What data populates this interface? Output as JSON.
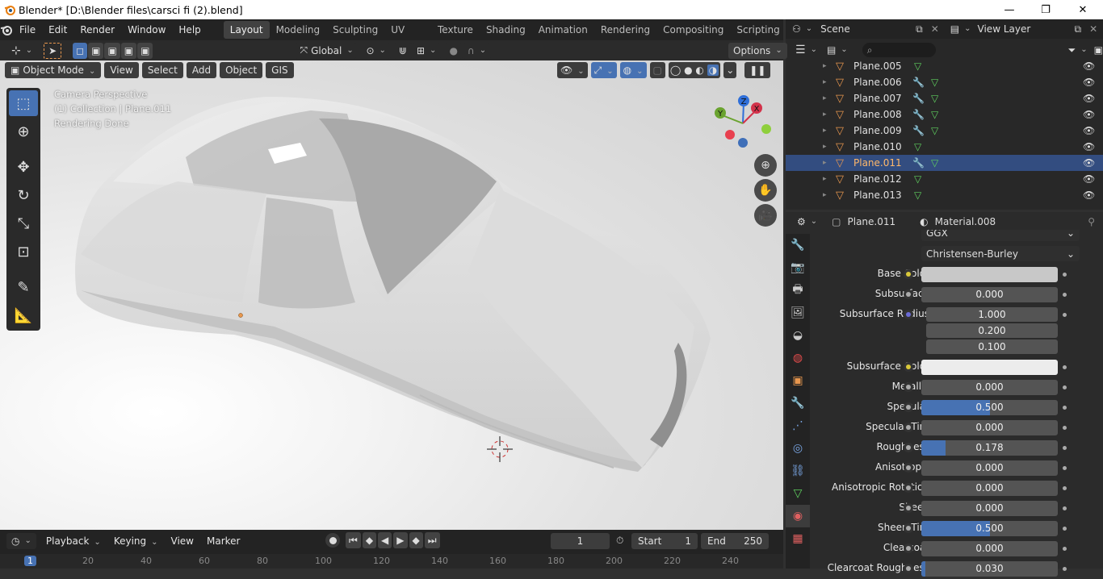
{
  "window": {
    "title": "Blender* [D:\\Blender files\\carsci fi (2).blend]",
    "minimize": "—",
    "restore": "❐",
    "close": "✕"
  },
  "menus": [
    "File",
    "Edit",
    "Render",
    "Window",
    "Help"
  ],
  "workspaces": [
    "Layout",
    "Modeling",
    "Sculpting",
    "UV Editing",
    "Texture Paint",
    "Shading",
    "Animation",
    "Rendering",
    "Compositing",
    "Scripting"
  ],
  "toolheader": {
    "orientation": "Global",
    "options": "Options"
  },
  "viewport": {
    "mode": "Object Mode",
    "menus": [
      "View",
      "Select",
      "Add",
      "Object",
      "GIS"
    ],
    "overlay_lines": [
      "Camera Perspective",
      "(1) Collection | Plane.011",
      "Rendering Done"
    ]
  },
  "gizmo": {
    "x": "X",
    "y": "Y",
    "z": "Z"
  },
  "scene": {
    "scene_name": "Scene",
    "view_layer": "View Layer"
  },
  "outliner": {
    "search_placeholder": "",
    "rows": [
      {
        "name": "Plane.005",
        "modifier": false,
        "selected": false
      },
      {
        "name": "Plane.006",
        "modifier": true,
        "selected": false
      },
      {
        "name": "Plane.007",
        "modifier": true,
        "selected": false
      },
      {
        "name": "Plane.008",
        "modifier": true,
        "selected": false
      },
      {
        "name": "Plane.009",
        "modifier": true,
        "selected": false
      },
      {
        "name": "Plane.010",
        "modifier": false,
        "selected": false
      },
      {
        "name": "Plane.011",
        "modifier": true,
        "selected": true
      },
      {
        "name": "Plane.012",
        "modifier": false,
        "selected": false
      },
      {
        "name": "Plane.013",
        "modifier": false,
        "selected": false
      }
    ]
  },
  "properties": {
    "object": "Plane.011",
    "material": "Material.008",
    "distribution": "GGX",
    "subsurface_method": "Christensen-Burley",
    "base_color": {
      "label": "Base Color",
      "color": "#c8c8c8"
    },
    "subsurface": {
      "label": "Subsurface",
      "value": "0.000",
      "fill": 0
    },
    "subsurface_radius": {
      "label": "Subsurface Radius",
      "values": [
        "1.000",
        "0.200",
        "0.100"
      ]
    },
    "subsurface_color": {
      "label": "Subsurface Color",
      "color": "#ececec"
    },
    "sliders": [
      {
        "label": "Metallic",
        "value": "0.000",
        "fill": 0
      },
      {
        "label": "Specular",
        "value": "0.500",
        "fill": 0.5
      },
      {
        "label": "Specular Tint",
        "value": "0.000",
        "fill": 0
      },
      {
        "label": "Roughness",
        "value": "0.178",
        "fill": 0.178
      },
      {
        "label": "Anisotropic",
        "value": "0.000",
        "fill": 0
      },
      {
        "label": "Anisotropic Rotation",
        "value": "0.000",
        "fill": 0
      },
      {
        "label": "Sheen",
        "value": "0.000",
        "fill": 0
      },
      {
        "label": "Sheen Tint",
        "value": "0.500",
        "fill": 0.5
      },
      {
        "label": "Clearcoat",
        "value": "0.000",
        "fill": 0
      },
      {
        "label": "Clearcoat Roughness",
        "value": "0.030",
        "fill": 0.03
      }
    ]
  },
  "timeline": {
    "menus": [
      "Playback",
      "Keying",
      "View",
      "Marker"
    ],
    "current_frame": "1",
    "start_label": "Start",
    "start": "1",
    "end_label": "End",
    "end": "250",
    "ticks": [
      "1",
      "20",
      "40",
      "60",
      "80",
      "100",
      "120",
      "140",
      "160",
      "180",
      "200",
      "220",
      "240"
    ]
  },
  "colors": {
    "accent": "#4772b3",
    "selection": "#334d80",
    "object_orange": "#e8974e",
    "mesh_green": "#5fce5f"
  }
}
